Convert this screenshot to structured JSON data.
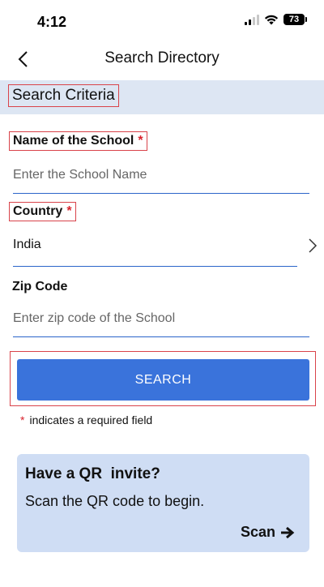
{
  "status_bar": {
    "time": "4:12",
    "battery": "73"
  },
  "nav": {
    "title": "Search Directory"
  },
  "section": {
    "title": "Search Criteria"
  },
  "form": {
    "required_marker": "*",
    "school": {
      "label": "Name of the School",
      "placeholder": "Enter the School Name",
      "value": ""
    },
    "country": {
      "label": "Country",
      "value": "India"
    },
    "zip": {
      "label": "Zip Code",
      "placeholder": "Enter zip code of the School",
      "value": ""
    },
    "search_label": "SEARCH",
    "required_note": "indicates a required field"
  },
  "qr_card": {
    "title": "Have a QR  invite?",
    "subtitle": "Scan the QR code to begin.",
    "scan_label": "Scan"
  },
  "colors": {
    "accent": "#3a73db",
    "section_bg": "#dde6f3",
    "card_bg": "#cfddf4",
    "required": "#d9232d"
  }
}
